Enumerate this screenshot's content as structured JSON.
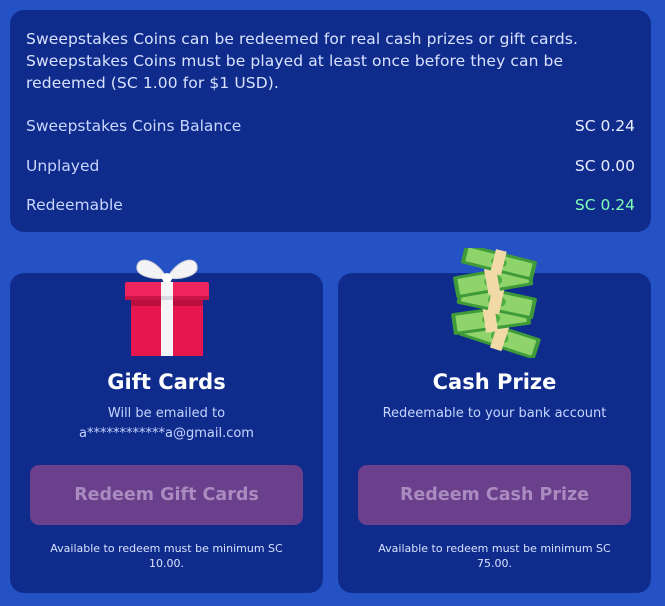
{
  "info": {
    "description": "Sweepstakes Coins can be redeemed for real cash prizes or gift cards. Sweepstakes Coins must be played at least once before they can be redeemed (SC 1.00 for $1 USD).",
    "balance_label": "Sweepstakes Coins Balance",
    "balance_value": "SC 0.24",
    "unplayed_label": "Unplayed",
    "unplayed_value": "SC 0.00",
    "redeemable_label": "Redeemable",
    "redeemable_value": "SC 0.24"
  },
  "gift_card": {
    "icon": "gift-box-icon",
    "title": "Gift Cards",
    "subtitle_line1": "Will be emailed to",
    "subtitle_line2": "a************a@gmail.com",
    "button_label": "Redeem Gift Cards",
    "note": "Available to redeem must be minimum SC 10.00."
  },
  "cash_prize": {
    "icon": "money-stack-icon",
    "title": "Cash Prize",
    "subtitle_line1": "Redeemable to your bank account",
    "button_label": "Redeem Cash Prize",
    "note": "Available to redeem must be minimum SC 75.00."
  },
  "colors": {
    "background": "#2451c4",
    "panel": "#0f2c8c",
    "redeemable_green": "#7fffb8",
    "button_disabled": "#6a3f8c"
  }
}
